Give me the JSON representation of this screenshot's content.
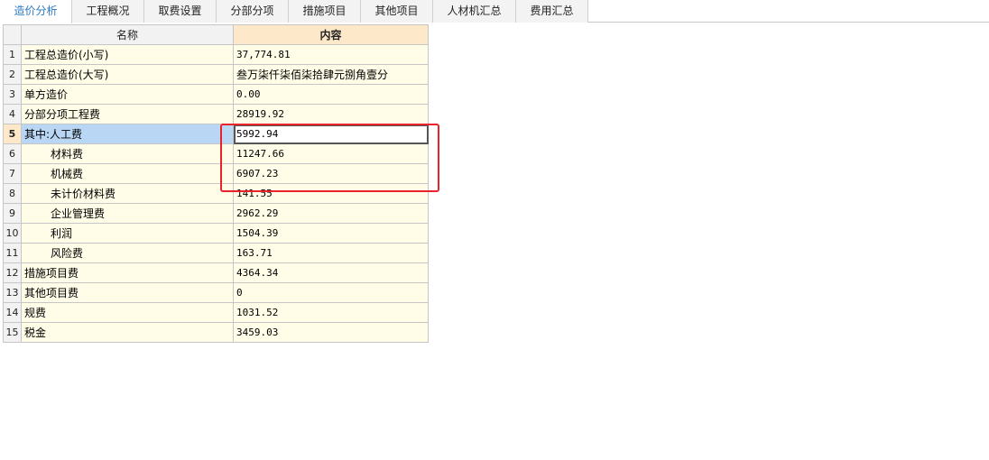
{
  "tabs": [
    {
      "label": "造价分析",
      "active": true
    },
    {
      "label": "工程概况",
      "active": false
    },
    {
      "label": "取费设置",
      "active": false
    },
    {
      "label": "分部分项",
      "active": false
    },
    {
      "label": "措施项目",
      "active": false
    },
    {
      "label": "其他项目",
      "active": false
    },
    {
      "label": "人材机汇总",
      "active": false
    },
    {
      "label": "费用汇总",
      "active": false
    }
  ],
  "table": {
    "headers": {
      "name": "名称",
      "content": "内容"
    },
    "selected_row": 5,
    "rows": [
      {
        "num": "1",
        "name": "工程总造价(小写)",
        "value": "37,774.81"
      },
      {
        "num": "2",
        "name": "工程总造价(大写)",
        "value": "叁万柒仟柒佰柒拾肆元捌角壹分"
      },
      {
        "num": "3",
        "name": "单方造价",
        "value": "0.00"
      },
      {
        "num": "4",
        "name": "分部分项工程费",
        "value": "28919.92"
      },
      {
        "num": "5",
        "name": "其中:人工费",
        "value": "5992.94"
      },
      {
        "num": "6",
        "name": "材料费",
        "value": "11247.66"
      },
      {
        "num": "7",
        "name": "机械费",
        "value": "6907.23"
      },
      {
        "num": "8",
        "name": "未计价材料费",
        "value": "141.55"
      },
      {
        "num": "9",
        "name": "企业管理费",
        "value": "2962.29"
      },
      {
        "num": "10",
        "name": "利润",
        "value": "1504.39"
      },
      {
        "num": "11",
        "name": "风险费",
        "value": "163.71"
      },
      {
        "num": "12",
        "name": "措施项目费",
        "value": "4364.34"
      },
      {
        "num": "13",
        "name": "其他项目费",
        "value": "0"
      },
      {
        "num": "14",
        "name": "规费",
        "value": "1031.52"
      },
      {
        "num": "15",
        "name": "税金",
        "value": "3459.03"
      }
    ]
  },
  "colors": {
    "accent": "#2b78c2",
    "highlight_box": "#e8232b",
    "cell_bg": "#fffde7",
    "header_content_bg": "#fde9c9",
    "selection_bg": "#b9d7f4"
  }
}
